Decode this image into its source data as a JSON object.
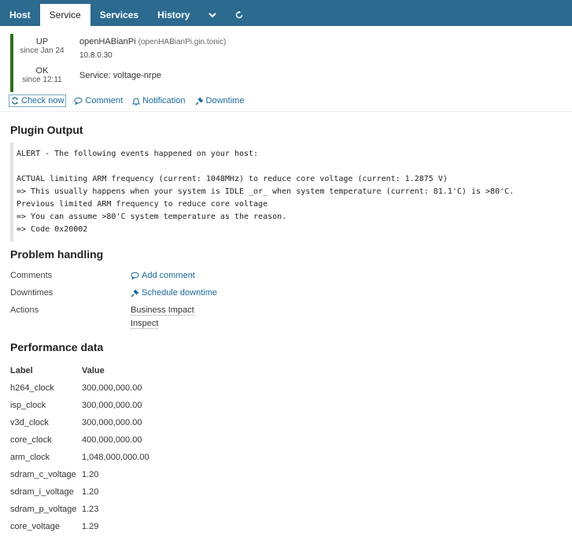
{
  "tabs": [
    {
      "label": "Host",
      "active": false
    },
    {
      "label": "Service",
      "active": true
    },
    {
      "label": "Services",
      "active": false
    },
    {
      "label": "History",
      "active": false
    }
  ],
  "tab_icons": [
    "chevron-down-icon",
    "refresh-icon"
  ],
  "host": {
    "state": "UP",
    "state_since": "since Jan 24",
    "name": "openHABianPi",
    "fqdn": "(openHABianPi.gin.tonic)",
    "ip": "10.8.0.30",
    "state_color": "#2f6f1a"
  },
  "service": {
    "state": "OK",
    "state_since": "since 12:11",
    "name": "Service: voltage-nrpe"
  },
  "actions": {
    "check_now": "Check now",
    "comment": "Comment",
    "notification": "Notification",
    "downtime": "Downtime"
  },
  "plugin_output": {
    "title": "Plugin Output",
    "text": "ALERT - The following events happened on your host:\n\nACTUAL limiting ARM frequency (current: 1048MHz) to reduce core voltage (current: 1.2875 V)\n=> This usually happens when your system is IDLE _or_ when system temperature (current: 81.1'C) is >80'C.\nPrevious limited ARM frequency to reduce core voltage\n=> You can assume >80'C system temperature as the reason.\n=> Code 0x20002"
  },
  "problem_handling": {
    "title": "Problem handling",
    "comments_label": "Comments",
    "add_comment": "Add comment",
    "downtimes_label": "Downtimes",
    "schedule_downtime": "Schedule downtime",
    "actions_label": "Actions",
    "business_impact": "Business Impact",
    "inspect": "Inspect"
  },
  "performance": {
    "title": "Performance data",
    "col_label": "Label",
    "col_value": "Value",
    "rows": [
      {
        "label": "h264_clock",
        "value": "300,000,000.00"
      },
      {
        "label": "isp_clock",
        "value": "300,000,000.00"
      },
      {
        "label": "v3d_clock",
        "value": "300,000,000.00"
      },
      {
        "label": "core_clock",
        "value": "400,000,000.00"
      },
      {
        "label": "arm_clock",
        "value": "1,048,000,000.00"
      },
      {
        "label": "sdram_c_voltage",
        "value": "1.20"
      },
      {
        "label": "sdram_i_voltage",
        "value": "1.20"
      },
      {
        "label": "sdram_p_voltage",
        "value": "1.23"
      },
      {
        "label": "core_voltage",
        "value": "1.29"
      }
    ]
  }
}
